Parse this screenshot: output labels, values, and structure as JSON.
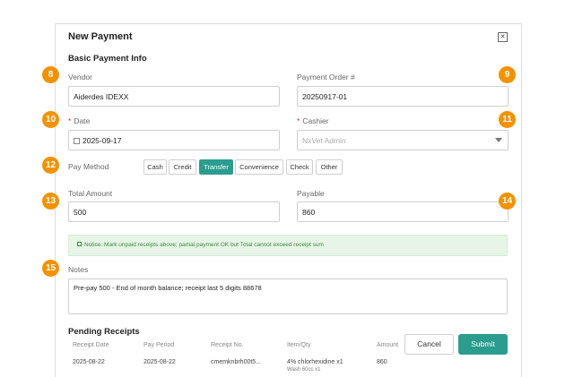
{
  "dialog": {
    "title": "New Payment",
    "close_icon": "close-icon",
    "section_title": "Basic Payment Info"
  },
  "form": {
    "vendor_label": "Vendor",
    "vendor_value": "Aiderdes IDEXX",
    "order_label": "Payment Order #",
    "order_value": "20250917-01",
    "date_label": "Date",
    "date_value": "2025-09-17",
    "cashier_label": "Cashier",
    "cashier_value": "NxVet Admin",
    "pay_method_label": "Pay Method",
    "pay_methods": [
      "Cash",
      "Credit",
      "Transfer",
      "Convenience",
      "Check",
      "Other"
    ],
    "pay_method_selected": "Transfer",
    "total_label": "Total Amount",
    "total_value": "500",
    "payable_label": "Payable",
    "payable_value": "860",
    "notice_text": "Notice: Mark unpaid receipts above; partial payment OK but Total cannot exceed receipt sum",
    "notes_label": "Notes",
    "notes_value": "Pre-pay 500 - End of month balance; receipt last 5 digits 88678"
  },
  "pending": {
    "title": "Pending Receipts",
    "columns": [
      "Receipt Date",
      "Pay Period",
      "Receipt No.",
      "Item/Qty",
      "Amount"
    ],
    "rows": [
      {
        "date": "2025-08-22",
        "period": "2025-08-22",
        "no": "cmemknbrh00t5...",
        "item": "4% chlorhexidine x1",
        "item2": "Wash 60cc x1",
        "amount": "860"
      }
    ]
  },
  "actions": {
    "cancel": "Cancel",
    "submit": "Submit"
  },
  "badges": [
    "8",
    "9",
    "10",
    "11",
    "12",
    "13",
    "14",
    "15"
  ],
  "colors": {
    "accent": "#2a9d8f",
    "badge": "#f39200",
    "notice_bg": "#e6f5e6",
    "required": "#d33333"
  }
}
